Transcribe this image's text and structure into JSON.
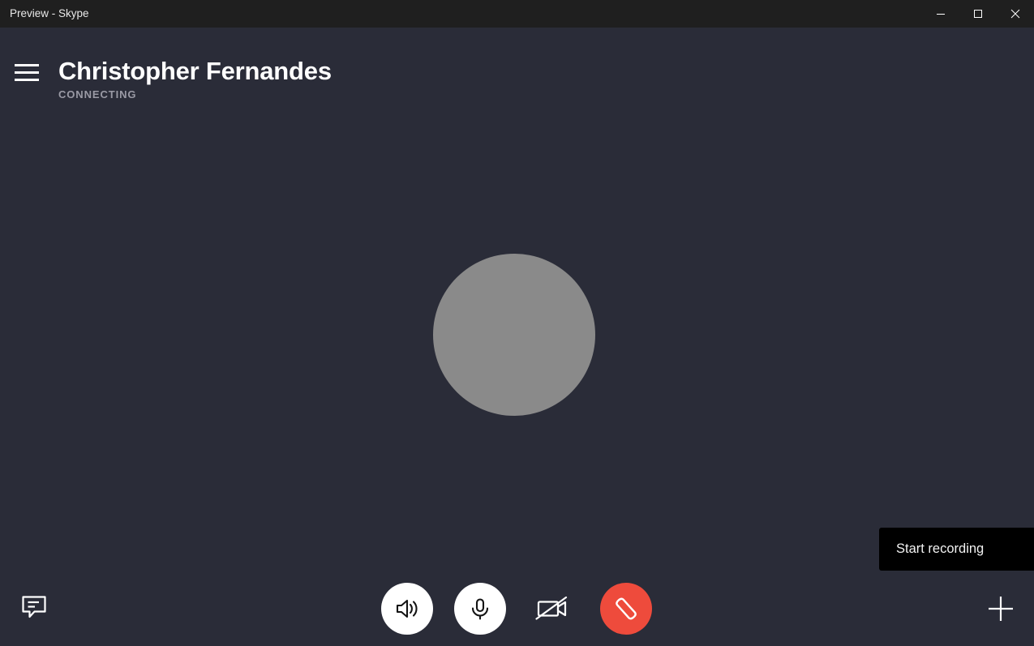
{
  "window": {
    "title": "Preview - Skype",
    "controls": {
      "minimize_label": "Minimize",
      "maximize_label": "Maximize",
      "close_label": "Close"
    }
  },
  "header": {
    "menu_label": "Menu",
    "caller_name": "Christopher Fernandes",
    "call_status": "CONNECTING"
  },
  "stage": {
    "avatar_label": "Christopher Fernandes avatar",
    "avatar_color": "#8a8a8a"
  },
  "tooltip": {
    "text": "Start recording"
  },
  "controls": {
    "chat_label": "Chat",
    "speaker_label": "Speaker",
    "microphone_label": "Microphone",
    "video_label": "Video off",
    "end_call_label": "End call",
    "add_people_label": "Add people",
    "end_call_color": "#ee4b3c",
    "button_color": "#ffffff"
  },
  "theme": {
    "background": "#2a2c38",
    "titlebar_background": "#1f1f1f",
    "title_text": "#ffffff",
    "status_text": "#9a9aa5",
    "tooltip_background": "#000000"
  }
}
